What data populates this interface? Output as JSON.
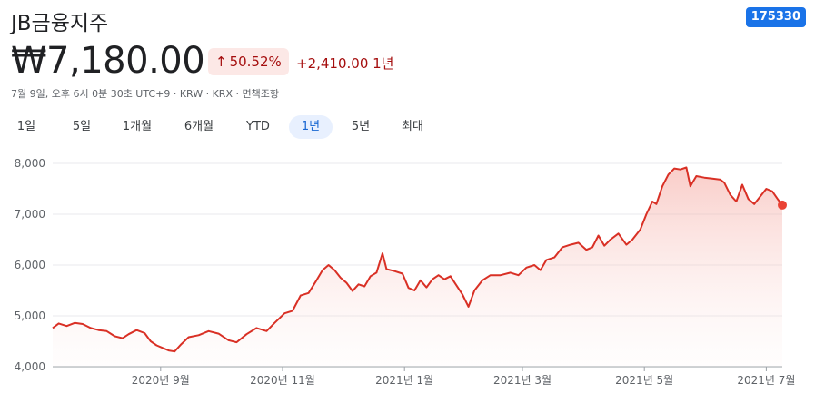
{
  "header": {
    "company_name": "JB금융지주",
    "ticker": "175330",
    "price": "₩7,180.00",
    "change_arrow": "↑",
    "change_percent": "50.52%",
    "change_amount": "+2,410.00 1년",
    "meta": "7월 9일, 오후 6시 0분 30초 UTC+9 · KRW · KRX · 면책조항"
  },
  "tabs": [
    {
      "label": "1일",
      "active": false
    },
    {
      "label": "5일",
      "active": false
    },
    {
      "label": "1개월",
      "active": false
    },
    {
      "label": "6개월",
      "active": false
    },
    {
      "label": "YTD",
      "active": false
    },
    {
      "label": "1년",
      "active": true
    },
    {
      "label": "5년",
      "active": false
    },
    {
      "label": "최대",
      "active": false
    }
  ],
  "colors": {
    "line": "#d93025",
    "fill": "#fce8e6",
    "grid": "#e8eaed",
    "tab_active_bg": "#e8f0fe",
    "tab_active_text": "#1967d2",
    "ticker_bg": "#1a73e8"
  },
  "chart_data": {
    "type": "area",
    "title": "",
    "xlabel": "",
    "ylabel": "",
    "ylim": [
      4000,
      8000
    ],
    "yticks": [
      4000,
      5000,
      6000,
      7000,
      8000
    ],
    "ytick_labels": [
      "4,000",
      "5,000",
      "6,000",
      "7,000",
      "8,000"
    ],
    "xticks": [
      "2020년 9월",
      "2020년 11월",
      "2021년 1월",
      "2021년 3월",
      "2021년 5월",
      "2021년 7월"
    ],
    "xtick_dates": [
      "2020-09-01",
      "2020-11-01",
      "2021-01-01",
      "2021-03-01",
      "2021-05-01",
      "2021-07-01"
    ],
    "x_range": [
      "2020-07-09",
      "2021-07-09"
    ],
    "series": [
      {
        "values": [
          {
            "x": "2020-07-09",
            "y": 4760
          },
          {
            "x": "2020-07-12",
            "y": 4850
          },
          {
            "x": "2020-07-16",
            "y": 4800
          },
          {
            "x": "2020-07-20",
            "y": 4860
          },
          {
            "x": "2020-07-24",
            "y": 4840
          },
          {
            "x": "2020-07-28",
            "y": 4760
          },
          {
            "x": "2020-08-01",
            "y": 4720
          },
          {
            "x": "2020-08-05",
            "y": 4700
          },
          {
            "x": "2020-08-09",
            "y": 4600
          },
          {
            "x": "2020-08-13",
            "y": 4560
          },
          {
            "x": "2020-08-16",
            "y": 4640
          },
          {
            "x": "2020-08-20",
            "y": 4720
          },
          {
            "x": "2020-08-24",
            "y": 4660
          },
          {
            "x": "2020-08-27",
            "y": 4500
          },
          {
            "x": "2020-08-30",
            "y": 4420
          },
          {
            "x": "2020-09-02",
            "y": 4370
          },
          {
            "x": "2020-09-05",
            "y": 4320
          },
          {
            "x": "2020-09-08",
            "y": 4300
          },
          {
            "x": "2020-09-11",
            "y": 4430
          },
          {
            "x": "2020-09-15",
            "y": 4580
          },
          {
            "x": "2020-09-20",
            "y": 4620
          },
          {
            "x": "2020-09-25",
            "y": 4700
          },
          {
            "x": "2020-09-30",
            "y": 4650
          },
          {
            "x": "2020-10-05",
            "y": 4520
          },
          {
            "x": "2020-10-09",
            "y": 4480
          },
          {
            "x": "2020-10-14",
            "y": 4640
          },
          {
            "x": "2020-10-19",
            "y": 4760
          },
          {
            "x": "2020-10-24",
            "y": 4700
          },
          {
            "x": "2020-10-28",
            "y": 4860
          },
          {
            "x": "2020-11-02",
            "y": 5050
          },
          {
            "x": "2020-11-06",
            "y": 5100
          },
          {
            "x": "2020-11-10",
            "y": 5400
          },
          {
            "x": "2020-11-14",
            "y": 5450
          },
          {
            "x": "2020-11-18",
            "y": 5700
          },
          {
            "x": "2020-11-21",
            "y": 5900
          },
          {
            "x": "2020-11-24",
            "y": 6000
          },
          {
            "x": "2020-11-27",
            "y": 5900
          },
          {
            "x": "2020-11-30",
            "y": 5750
          },
          {
            "x": "2020-12-03",
            "y": 5650
          },
          {
            "x": "2020-12-06",
            "y": 5490
          },
          {
            "x": "2020-12-09",
            "y": 5620
          },
          {
            "x": "2020-12-12",
            "y": 5580
          },
          {
            "x": "2020-12-15",
            "y": 5780
          },
          {
            "x": "2020-12-18",
            "y": 5850
          },
          {
            "x": "2020-12-21",
            "y": 6230
          },
          {
            "x": "2020-12-23",
            "y": 5920
          },
          {
            "x": "2020-12-27",
            "y": 5880
          },
          {
            "x": "2020-12-31",
            "y": 5830
          },
          {
            "x": "2021-01-03",
            "y": 5550
          },
          {
            "x": "2021-01-06",
            "y": 5500
          },
          {
            "x": "2021-01-09",
            "y": 5700
          },
          {
            "x": "2021-01-12",
            "y": 5560
          },
          {
            "x": "2021-01-15",
            "y": 5720
          },
          {
            "x": "2021-01-18",
            "y": 5800
          },
          {
            "x": "2021-01-21",
            "y": 5720
          },
          {
            "x": "2021-01-24",
            "y": 5780
          },
          {
            "x": "2021-01-27",
            "y": 5600
          },
          {
            "x": "2021-01-30",
            "y": 5420
          },
          {
            "x": "2021-02-02",
            "y": 5180
          },
          {
            "x": "2021-02-05",
            "y": 5500
          },
          {
            "x": "2021-02-09",
            "y": 5700
          },
          {
            "x": "2021-02-13",
            "y": 5800
          },
          {
            "x": "2021-02-18",
            "y": 5800
          },
          {
            "x": "2021-02-23",
            "y": 5850
          },
          {
            "x": "2021-02-27",
            "y": 5800
          },
          {
            "x": "2021-03-03",
            "y": 5950
          },
          {
            "x": "2021-03-07",
            "y": 6000
          },
          {
            "x": "2021-03-10",
            "y": 5900
          },
          {
            "x": "2021-03-13",
            "y": 6100
          },
          {
            "x": "2021-03-17",
            "y": 6150
          },
          {
            "x": "2021-03-21",
            "y": 6350
          },
          {
            "x": "2021-03-25",
            "y": 6400
          },
          {
            "x": "2021-03-29",
            "y": 6440
          },
          {
            "x": "2021-04-02",
            "y": 6300
          },
          {
            "x": "2021-04-05",
            "y": 6350
          },
          {
            "x": "2021-04-08",
            "y": 6580
          },
          {
            "x": "2021-04-11",
            "y": 6380
          },
          {
            "x": "2021-04-14",
            "y": 6500
          },
          {
            "x": "2021-04-18",
            "y": 6620
          },
          {
            "x": "2021-04-22",
            "y": 6400
          },
          {
            "x": "2021-04-25",
            "y": 6500
          },
          {
            "x": "2021-04-29",
            "y": 6700
          },
          {
            "x": "2021-05-02",
            "y": 7000
          },
          {
            "x": "2021-05-05",
            "y": 7250
          },
          {
            "x": "2021-05-07",
            "y": 7200
          },
          {
            "x": "2021-05-10",
            "y": 7550
          },
          {
            "x": "2021-05-13",
            "y": 7780
          },
          {
            "x": "2021-05-16",
            "y": 7900
          },
          {
            "x": "2021-05-19",
            "y": 7880
          },
          {
            "x": "2021-05-22",
            "y": 7920
          },
          {
            "x": "2021-05-24",
            "y": 7550
          },
          {
            "x": "2021-05-27",
            "y": 7750
          },
          {
            "x": "2021-05-31",
            "y": 7720
          },
          {
            "x": "2021-06-04",
            "y": 7700
          },
          {
            "x": "2021-06-08",
            "y": 7680
          },
          {
            "x": "2021-06-10",
            "y": 7620
          },
          {
            "x": "2021-06-13",
            "y": 7380
          },
          {
            "x": "2021-06-16",
            "y": 7250
          },
          {
            "x": "2021-06-19",
            "y": 7580
          },
          {
            "x": "2021-06-22",
            "y": 7300
          },
          {
            "x": "2021-06-25",
            "y": 7200
          },
          {
            "x": "2021-06-28",
            "y": 7350
          },
          {
            "x": "2021-07-01",
            "y": 7500
          },
          {
            "x": "2021-07-04",
            "y": 7450
          },
          {
            "x": "2021-07-07",
            "y": 7280
          },
          {
            "x": "2021-07-09",
            "y": 7180
          }
        ]
      }
    ],
    "grid": "horizontal",
    "legend": "none"
  }
}
